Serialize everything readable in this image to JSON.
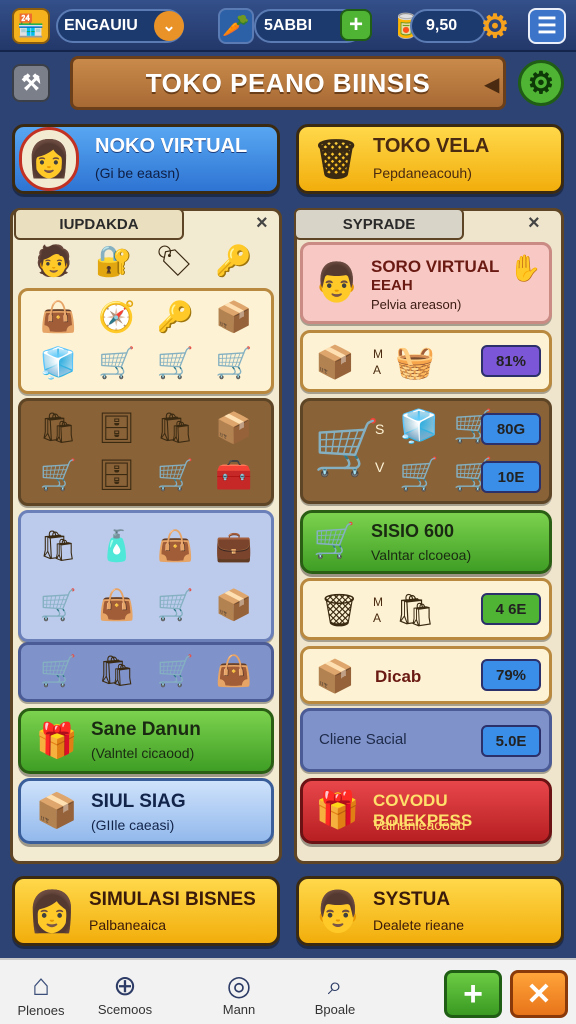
{
  "topbar": {
    "player_name": "ENGAUIU",
    "currency1": "5ABBI",
    "currency2": "9,50"
  },
  "title": "TOKO PEANO BIINSIS",
  "cards": {
    "left": {
      "title": "NOKO VIRTUAL",
      "subtitle": "(Gi be eaasn)"
    },
    "right": {
      "title": "TOKO VELA",
      "subtitle": "Pepdaneacouh)"
    }
  },
  "left_panel": {
    "header": "IUPDAKDA",
    "close": "×",
    "row0": [
      "🧑",
      "🔐",
      "🏷",
      "🔑"
    ],
    "grid_a": [
      "👜",
      "🧭",
      "🔑",
      "📦",
      "🧊",
      "🛒",
      "🛒",
      "🛒"
    ],
    "grid_b": [
      "🛍",
      "🗄",
      "🛍",
      "📦",
      "🛒",
      "🗄",
      "🛒",
      "🧰"
    ],
    "grid_c": [
      "🛍",
      "🧴",
      "👜",
      "💼",
      "🛒",
      "👜",
      "🛒",
      "📦"
    ],
    "grid_d": [
      "🛒",
      "🛍",
      "🛒",
      "👜"
    ],
    "btn1": {
      "title": "Sane Danun",
      "subtitle": "(Valntel cicaood)"
    },
    "btn2": {
      "title": "SIUL SIAG",
      "subtitle": "(GIIle caeasi)"
    }
  },
  "right_panel": {
    "header": "SYPRADE",
    "close": "×",
    "promo": {
      "title": "SORO VIRTUAL",
      "title2": "EEAH",
      "subtitle": "Pelvia areason)"
    },
    "rows": [
      {
        "m1": "M",
        "m2": "A",
        "badge": "81%"
      },
      {
        "m1": "S",
        "m2": "V",
        "badge1": "80G",
        "badge2": "10E"
      },
      {
        "title": "SISIO 600",
        "subtitle": "Valntar clcoeoa)"
      },
      {
        "m1": "M",
        "m2": "A",
        "badge": "4 6E"
      },
      {
        "label": "Dicab",
        "badge": "79%"
      },
      {
        "label": "Cliene Sacial",
        "badge": "5.0E"
      },
      {
        "title": "COVODU BOIEKPESS",
        "subtitle": "Valhanleaoodd"
      }
    ]
  },
  "bottom": {
    "left": {
      "title": "SIMULASI BISNES",
      "subtitle": "Palbaneaica"
    },
    "right": {
      "title": "SYSTUA",
      "subtitle": "Dealete rieane"
    }
  },
  "nav": {
    "items": [
      "Plenoes",
      "Scemoos",
      "Mann",
      "Bpoale"
    ],
    "add": "+",
    "close": "✕"
  },
  "colors": {
    "accent": "#f5b400",
    "blue": "#3a8ee8",
    "green": "#4fb334",
    "red": "#d93a3a"
  }
}
